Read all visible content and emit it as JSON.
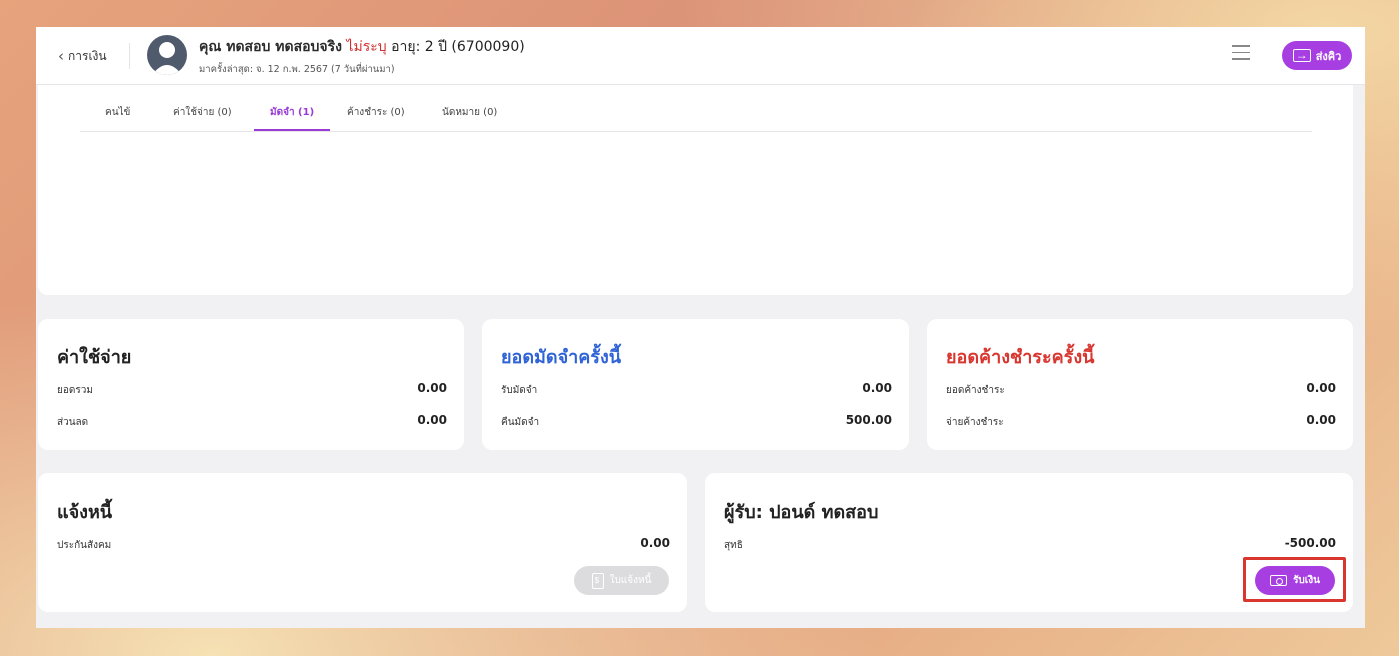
{
  "header": {
    "back_label": "การเงิน",
    "name": "คุณ ทดสอบ ทดสอบจริง",
    "sex": "ไม่ระบุ",
    "age_hn": "อายุ: 2 ปี (6700090)",
    "last_visit": "มาครั้งล่าสุด: จ. 12 ก.พ. 2567 (7 วันที่ผ่านมา)",
    "send_queue_label": "ส่งคิว"
  },
  "tabs": [
    {
      "label": "คนไข้"
    },
    {
      "label": "ค่าใช้จ่าย (0)"
    },
    {
      "label": "มัดจำ (1)"
    },
    {
      "label": "ค้างชำระ (0)"
    },
    {
      "label": "นัดหมาย (0)"
    }
  ],
  "expenses": {
    "title": "ค่าใช้จ่าย",
    "rows": [
      {
        "label": "ยอดรวม",
        "value": "0.00"
      },
      {
        "label": "ส่วนลด",
        "value": "0.00"
      }
    ]
  },
  "deposit": {
    "title": "ยอดมัดจำครั้งนี้",
    "rows": [
      {
        "label": "รับมัดจำ",
        "value": "0.00"
      },
      {
        "label": "คืนมัดจำ",
        "value": "500.00"
      }
    ]
  },
  "outstanding": {
    "title": "ยอดค้างชำระครั้งนี้",
    "rows": [
      {
        "label": "ยอดค้างชำระ",
        "value": "0.00"
      },
      {
        "label": "จ่ายค้างชำระ",
        "value": "0.00"
      }
    ]
  },
  "debt_notice": {
    "title": "แจ้งหนี้",
    "rows": [
      {
        "label": "ประกันสังคม",
        "value": "0.00"
      }
    ],
    "button_label": "ใบแจ้งหนี้"
  },
  "payee": {
    "title": "ผู้รับ: ปอนด์ ทดสอบ",
    "rows": [
      {
        "label": "สุทธิ",
        "value": "-500.00"
      }
    ],
    "button_label": "รับเงิน"
  },
  "colors": {
    "accent": "#a73ee2",
    "deposit_title": "#2f63d6",
    "outstanding_title": "#d8362f",
    "highlight": "#d8362f"
  }
}
